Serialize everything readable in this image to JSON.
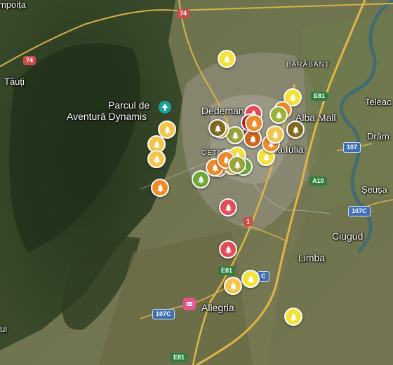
{
  "map": {
    "places": {
      "parc_line1": "Parcul de",
      "parc_line2": "Aventură Dynamis",
      "dedeman": "Dedeman",
      "alba_mall": "Alba Mall",
      "alba_iulia": "Alba Iulia",
      "cetate": "CETATE",
      "barabant": "BĂRĂBANȚ",
      "tauti": "Tăuți",
      "teleac": "Teleac",
      "drambar": "Drâm",
      "seusa": "Șeuşa",
      "ciugud": "Ciugud",
      "limba": "Limba",
      "allegria": "Allegria",
      "impoita": "mpoița",
      "edge_left": "ui"
    },
    "roads": {
      "r74_top": "74",
      "r74_left": "74",
      "e81_top": "E81",
      "r107": "107",
      "r107c_right": "107C",
      "e81_mid": "E81",
      "r1": "1",
      "c_badge": "C",
      "r107c_left": "107C",
      "e81_bottom": "E81",
      "a10": "A10"
    },
    "icons": [
      "park-icon",
      "cinema-icon",
      "tree-icon"
    ],
    "markers": [
      {
        "color": "#f4e13a"
      },
      {
        "color": "#f3c54d"
      },
      {
        "color": "#f4e13a"
      },
      {
        "color": "#f3c54d"
      },
      {
        "color": "#f3c54d"
      },
      {
        "color": "#ee8a2a"
      },
      {
        "color": "#e34b57"
      },
      {
        "color": "#e34b57"
      },
      {
        "color": "#f3c54d"
      },
      {
        "color": "#f4e13a"
      },
      {
        "color": "#f4e13a"
      },
      {
        "color": "#f3c54d"
      },
      {
        "color": "#e34b57"
      },
      {
        "color": "#ee8a2a"
      },
      {
        "color": "#b2263c"
      },
      {
        "color": "#9aa23a"
      },
      {
        "color": "#f4e13a"
      },
      {
        "color": "#ee8a2a"
      },
      {
        "color": "#7d6a1e"
      },
      {
        "color": "#9bb236"
      },
      {
        "color": "#f3c54d"
      },
      {
        "color": "#ee8a2a"
      },
      {
        "color": "#b2263c"
      },
      {
        "color": "#cc6519"
      },
      {
        "color": "#f3c54d"
      },
      {
        "color": "#f4e13a"
      },
      {
        "color": "#f3c54d"
      },
      {
        "color": "#ee8a2a"
      },
      {
        "color": "#ee8a2a"
      },
      {
        "color": "#f3c54d"
      },
      {
        "color": "#ee8a2a"
      },
      {
        "color": "#6ea83a"
      },
      {
        "color": "#6ea83a"
      },
      {
        "color": "#9aa23a"
      },
      {
        "color": "#7d6a1e"
      }
    ]
  }
}
